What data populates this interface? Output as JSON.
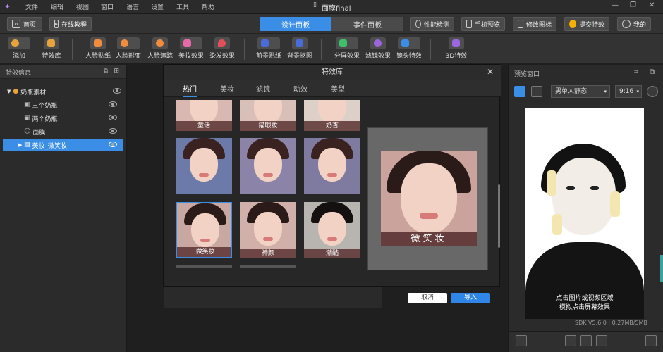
{
  "app": {
    "title": "面膜final",
    "menu": [
      "文件",
      "编辑",
      "视图",
      "窗口",
      "语言",
      "设置",
      "工具",
      "帮助"
    ]
  },
  "nav": {
    "home": "首页",
    "tutorial": "在线教程",
    "tab_design": "设计面板",
    "tab_event": "事件面板",
    "perf": "性能检测",
    "mobile": "手机预览",
    "modify_icon": "修改图标",
    "submit": "提交特效",
    "mine": "我的"
  },
  "toolbar": {
    "add": "添加",
    "effects_lib": "特效库",
    "face_sticker": "人脸贴纸",
    "face_warp": "人脸形变",
    "face_track": "人脸追踪",
    "makeup": "美妆效果",
    "hair_dye": "染发效果",
    "fg_sticker": "前景贴纸",
    "bg_matting": "背景抠图",
    "split_screen": "分屏效果",
    "filter": "滤镜效果",
    "lens": "镜头特效",
    "fx3d": "3D特效"
  },
  "left": {
    "header": "特效信息",
    "items": [
      {
        "label": "奶瓶素材"
      },
      {
        "label": "三个奶瓶"
      },
      {
        "label": "两个奶瓶"
      },
      {
        "label": "面膜"
      },
      {
        "label": "美妆_微笑妆"
      }
    ]
  },
  "dialog": {
    "title": "特效库",
    "tabs": [
      "热门",
      "美妆",
      "滤镜",
      "动效",
      "美型"
    ],
    "cards": [
      "童话",
      "猫眼妆",
      "奶杏",
      "",
      "",
      "",
      "微笑妆",
      "神颜",
      "潮酷"
    ],
    "preview_label": "微笑妆",
    "cancel": "取消",
    "import": "导入"
  },
  "right": {
    "header": "预览窗口",
    "model": "男单人静态",
    "ratio": "9:16",
    "hint1": "点击图片或视频区域",
    "hint2": "模拟点击屏幕效果",
    "sdk": "SDK V5.6.0",
    "mem": "0.27MB/5MB"
  },
  "colors": {
    "accent": "#2f86e6",
    "active_row": "#3a8ee6"
  }
}
